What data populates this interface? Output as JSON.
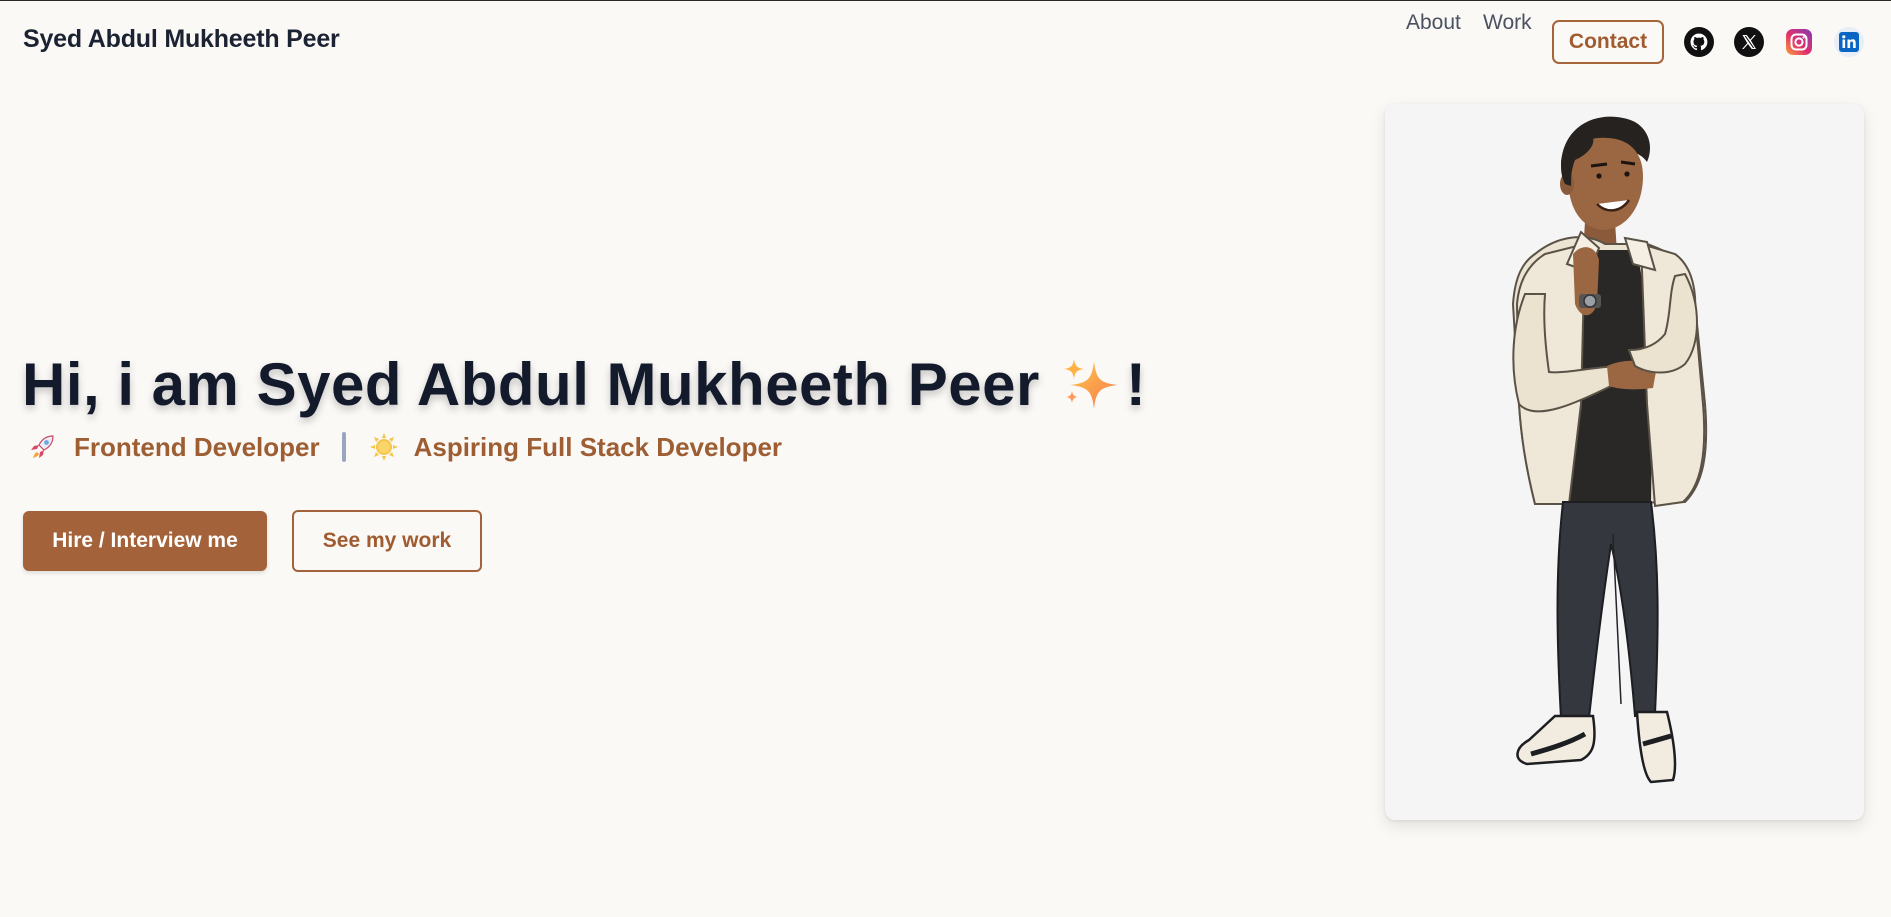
{
  "header": {
    "brand": "Syed Abdul Mukheeth Peer",
    "nav": [
      {
        "label": "About"
      },
      {
        "label": "Work"
      }
    ],
    "contact_label": "Contact",
    "social_icons": [
      "github-icon",
      "x-icon",
      "instagram-icon",
      "linkedin-icon"
    ]
  },
  "hero": {
    "title": "Hi, i am Syed Abdul Mukheeth Peer",
    "title_suffix": "!",
    "roles": [
      {
        "icon": "rocket-icon",
        "text": "Frontend Developer"
      },
      {
        "icon": "sun-icon",
        "text": "Aspiring Full Stack Developer"
      }
    ],
    "primary_button": "Hire / Interview me",
    "secondary_button": "See my work"
  },
  "colors": {
    "background": "#fbf9f6",
    "accent": "#a4623a",
    "heading": "#131a2b"
  }
}
